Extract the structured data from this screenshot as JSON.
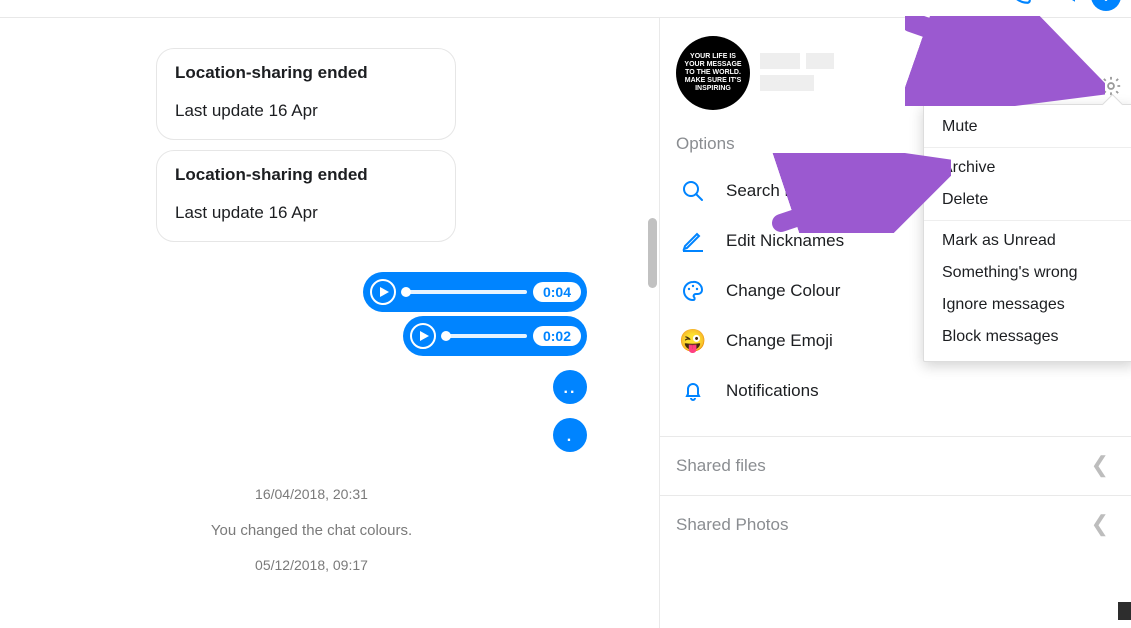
{
  "topbar": {},
  "chat": {
    "location_ended": "Location-sharing ended",
    "last_update": "Last update 16 Apr",
    "audio1_time": "0:04",
    "audio2_time": "0:02",
    "dots1": "..",
    "dots2": ".",
    "ts1": "16/04/2018, 20:31",
    "system_msg": "You changed the chat colours.",
    "ts2": "05/12/2018, 09:17"
  },
  "side": {
    "avatar_text": "YOUR LIFE IS YOUR MESSAGE TO THE WORLD. MAKE SURE IT'S INSPIRING",
    "options_label": "Options",
    "search": "Search in Conversation",
    "nick": "Edit Nicknames",
    "colour": "Change Colour",
    "emoji": "Change Emoji",
    "notif": "Notifications",
    "files": "Shared files",
    "photos": "Shared Photos"
  },
  "menu": {
    "mute": "Mute",
    "archive": "Archive",
    "delete": "Delete",
    "unread": "Mark as Unread",
    "wrong": "Something's wrong",
    "ignore": "Ignore messages",
    "block": "Block messages"
  }
}
